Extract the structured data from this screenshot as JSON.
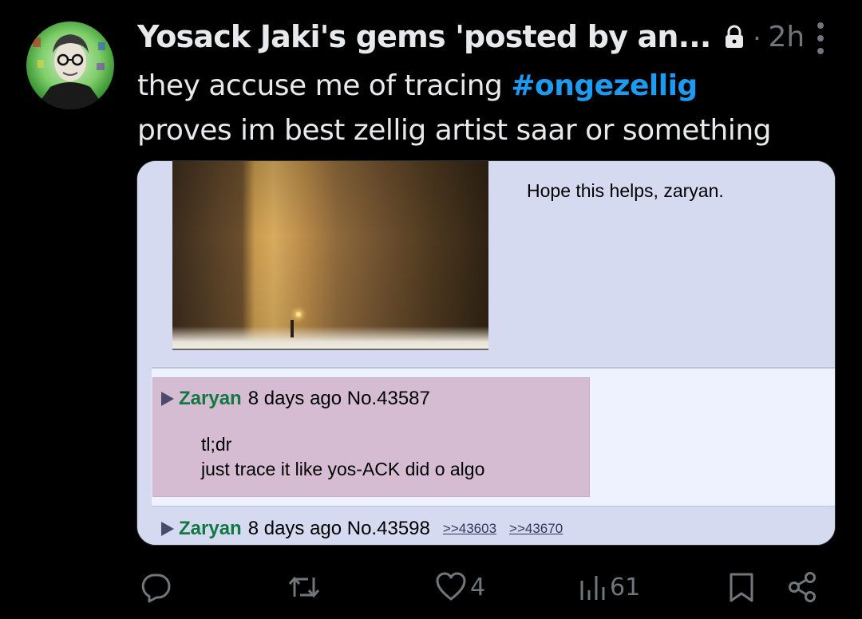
{
  "tweet": {
    "author": "Yosack Jaki's gems 'posted by an...",
    "separator": "·",
    "time": "2h",
    "text_before_hashtag": "they accuse me of tracing ",
    "hashtag": "#ongezellig",
    "text_line2": "proves im best zellig artist saar or something"
  },
  "media": {
    "post1_text": "Hope this helps, zaryan.",
    "post2": {
      "name": "Zaryan",
      "meta": "8 days ago No.43587",
      "line1": "tl;dr",
      "line2": "just trace it like yos-ACK did o algo"
    },
    "post3": {
      "name": "Zaryan",
      "meta": "8 days ago No.43598",
      "quote1": ">>43603",
      "quote2": ">>43670"
    }
  },
  "actions": {
    "replies": "",
    "reposts": "",
    "likes": "4",
    "views": "61"
  },
  "colors": {
    "background": "#000000",
    "text": "#e7e9ea",
    "muted": "#71767b",
    "hashtag": "#1d9bf0",
    "board_bg": "#d6daf0",
    "reply_highlight": "#d5bcd2",
    "poster_name": "#117743"
  },
  "icons": [
    "lock-icon",
    "more-icon",
    "reply-icon",
    "repost-icon",
    "like-icon",
    "views-icon",
    "bookmark-icon",
    "share-icon"
  ]
}
